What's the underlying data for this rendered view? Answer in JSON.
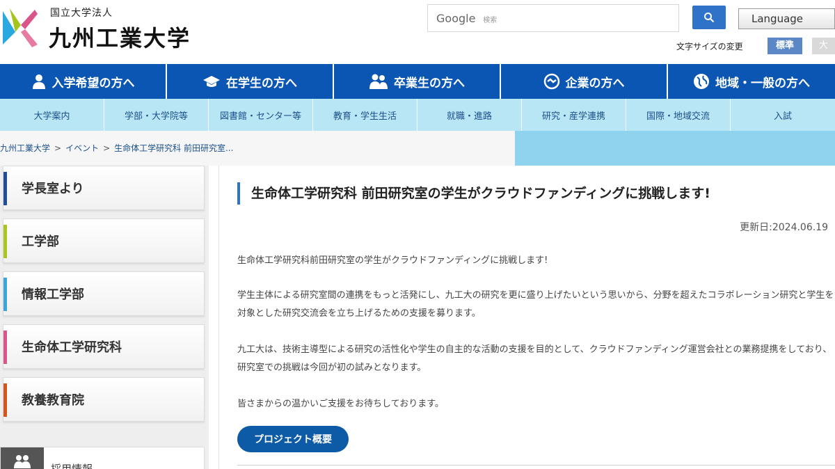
{
  "header": {
    "org_type": "国立大学法人",
    "university_name": "九州工業大学",
    "search_placeholder": "Google",
    "search_suffix": "検索",
    "language_label": "Language",
    "font_size_label": "文字サイズの変更",
    "font_size_standard": "標準",
    "font_size_large": "大"
  },
  "main_nav": [
    {
      "label": "入学希望の方へ",
      "icon": "person-icon"
    },
    {
      "label": "在学生の方へ",
      "icon": "graduation-cap-icon"
    },
    {
      "label": "卒業生の方へ",
      "icon": "people-icon"
    },
    {
      "label": "企業の方へ",
      "icon": "handshake-icon"
    },
    {
      "label": "地域・一般の方へ",
      "icon": "globe-icon"
    }
  ],
  "sub_nav": [
    "大学案内",
    "学部・大学院等",
    "図書館・センター等",
    "教育・学生生活",
    "就職・進路",
    "研究・産学連携",
    "国際・地域交流",
    "入試"
  ],
  "breadcrumb": [
    "九州工業大学",
    "イベント",
    "生命体工学研究科 前田研究室..."
  ],
  "breadcrumb_sep": ">",
  "sidebar": [
    {
      "label": "学長室より",
      "color": "#1f4e9c"
    },
    {
      "label": "工学部",
      "color": "#a9c61f"
    },
    {
      "label": "情報工学部",
      "color": "#3aa6dd"
    },
    {
      "label": "生命体工学研究科",
      "color": "#d9568a"
    },
    {
      "label": "教養教育院",
      "color": "#d4561c"
    }
  ],
  "sidebar_sub": {
    "label": "採用情報",
    "icon": "people-icon"
  },
  "article": {
    "title": "生命体工学研究科 前田研究室の学生がクラウドファンディングに挑戦します!",
    "updated": "更新日:2024.06.19",
    "paragraphs": [
      "生命体工学研究科前田研究室の学生がクラウドファンディングに挑戦します!",
      "学生主体による研究室間の連携をもっと活発にし、九工大の研究を更に盛り上げたいという思いから、分野を超えたコラボレーション研究と学生を対象とした研究交流会を立ち上げるための支援を募ります。",
      "九工大は、技術主導型による研究の活性化や学生の自主的な活動の支援を目的として、クラウドファンディング運営会社との業務提携をしており、研究室での挑戦は今回が初の試みとなります。",
      "皆さまからの温かいご支援をお待ちしております。"
    ],
    "project_button": "プロジェクト概要"
  },
  "colors": {
    "main_nav_bg": "#0b56b3",
    "sub_nav_bg": "#b9e6f5",
    "breadcrumb_accent": "#8fd3ee",
    "button_blue": "#0d5aa7"
  }
}
